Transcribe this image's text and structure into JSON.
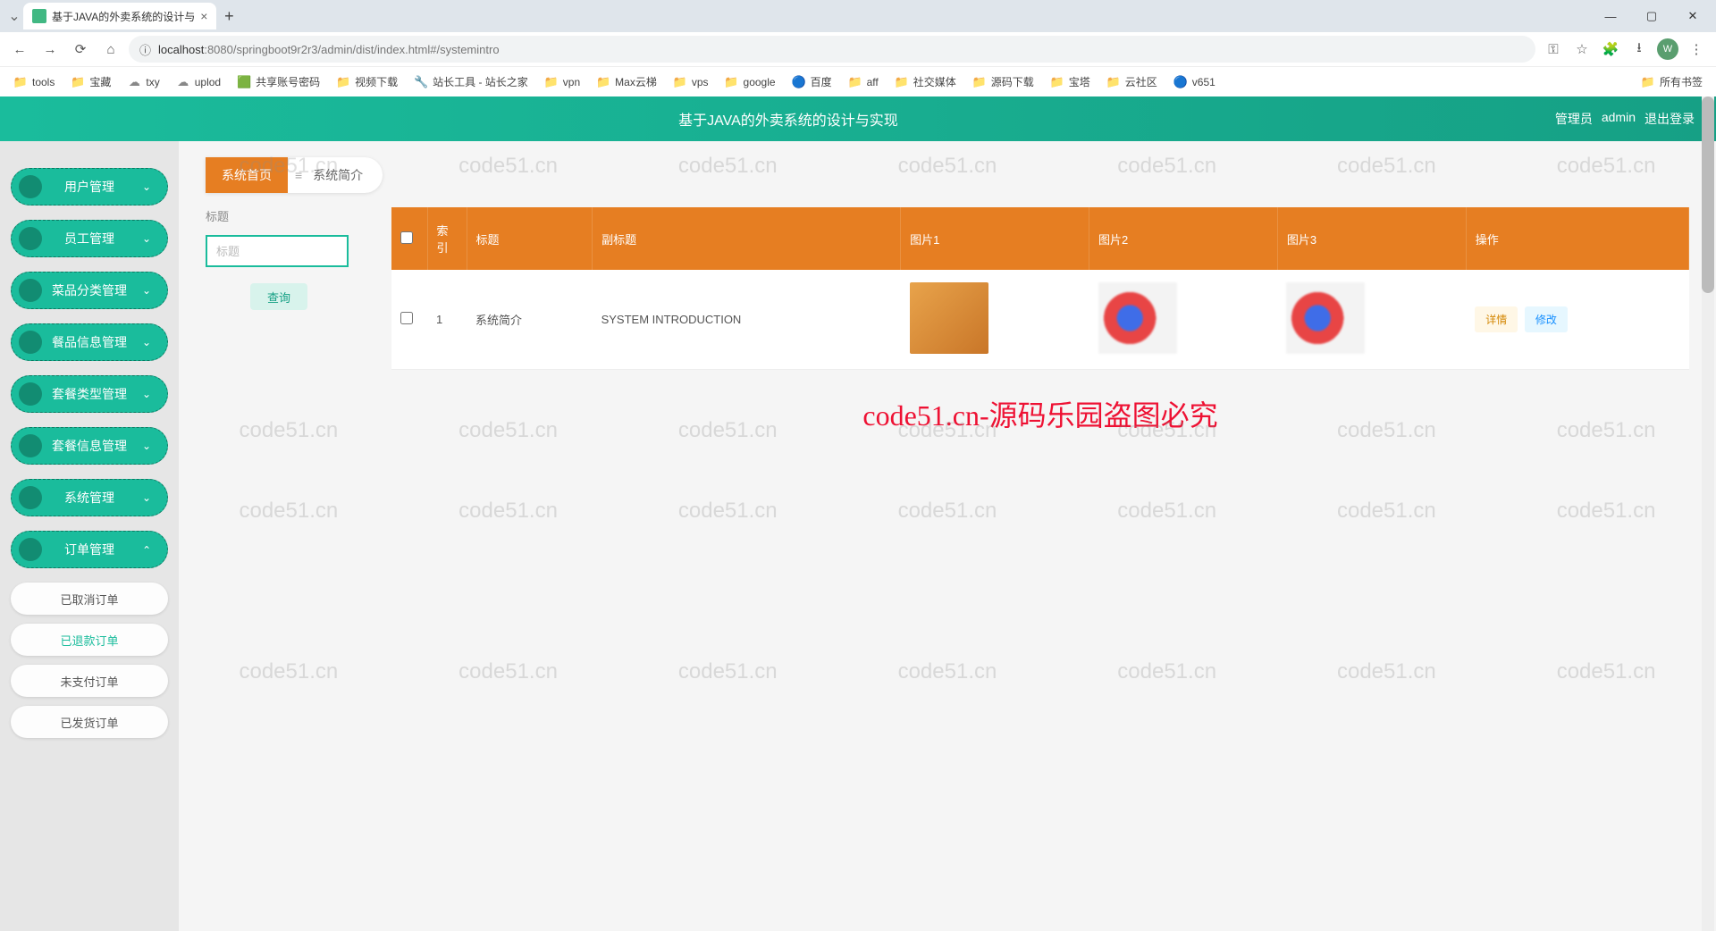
{
  "browser": {
    "tab_title": "基于JAVA的外卖系统的设计与",
    "url_host": "localhost",
    "url_path": ":8080/springboot9r2r3/admin/dist/index.html#/systemintro",
    "avatar_letter": "W",
    "bookmarks": [
      {
        "icon": "📁",
        "label": "tools"
      },
      {
        "icon": "📁",
        "label": "宝藏"
      },
      {
        "icon": "☁",
        "label": "txy"
      },
      {
        "icon": "☁",
        "label": "uplod"
      },
      {
        "icon": "🟩",
        "label": "共享账号密码"
      },
      {
        "icon": "📁",
        "label": "视频下载"
      },
      {
        "icon": "🔧",
        "label": "站长工具 - 站长之家"
      },
      {
        "icon": "📁",
        "label": "vpn"
      },
      {
        "icon": "📁",
        "label": "Max云梯"
      },
      {
        "icon": "📁",
        "label": "vps"
      },
      {
        "icon": "📁",
        "label": "google"
      },
      {
        "icon": "🔵",
        "label": "百度"
      },
      {
        "icon": "📁",
        "label": "aff"
      },
      {
        "icon": "📁",
        "label": "社交媒体"
      },
      {
        "icon": "📁",
        "label": "源码下载"
      },
      {
        "icon": "📁",
        "label": "宝塔"
      },
      {
        "icon": "📁",
        "label": "云社区"
      },
      {
        "icon": "🔵",
        "label": "v651"
      }
    ],
    "bookmark_right": {
      "icon": "📁",
      "label": "所有书签"
    }
  },
  "header": {
    "title": "基于JAVA的外卖系统的设计与实现",
    "role": "管理员",
    "user": "admin",
    "logout": "退出登录"
  },
  "sidebar": {
    "items": [
      {
        "label": "用户管理"
      },
      {
        "label": "员工管理"
      },
      {
        "label": "菜品分类管理"
      },
      {
        "label": "餐品信息管理"
      },
      {
        "label": "套餐类型管理"
      },
      {
        "label": "套餐信息管理"
      },
      {
        "label": "系统管理"
      },
      {
        "label": "订单管理"
      }
    ],
    "subitems": [
      {
        "label": "已取消订单"
      },
      {
        "label": "已退款订单"
      },
      {
        "label": "未支付订单"
      },
      {
        "label": "已发货订单"
      }
    ]
  },
  "breadcrumb": {
    "home": "系统首页",
    "sep_icon": "≡",
    "current": "系统简介"
  },
  "search": {
    "label": "标题",
    "placeholder": "标题",
    "button": "查询"
  },
  "table": {
    "headers": [
      "",
      "索引",
      "标题",
      "副标题",
      "图片1",
      "图片2",
      "图片3",
      "操作"
    ],
    "row": {
      "index": "1",
      "title": "系统简介",
      "subtitle": "SYSTEM INTRODUCTION"
    },
    "actions": {
      "detail": "详情",
      "edit": "修改"
    }
  },
  "watermark": "code51.cn",
  "bigtext": "code51.cn-源码乐园盗图必究"
}
